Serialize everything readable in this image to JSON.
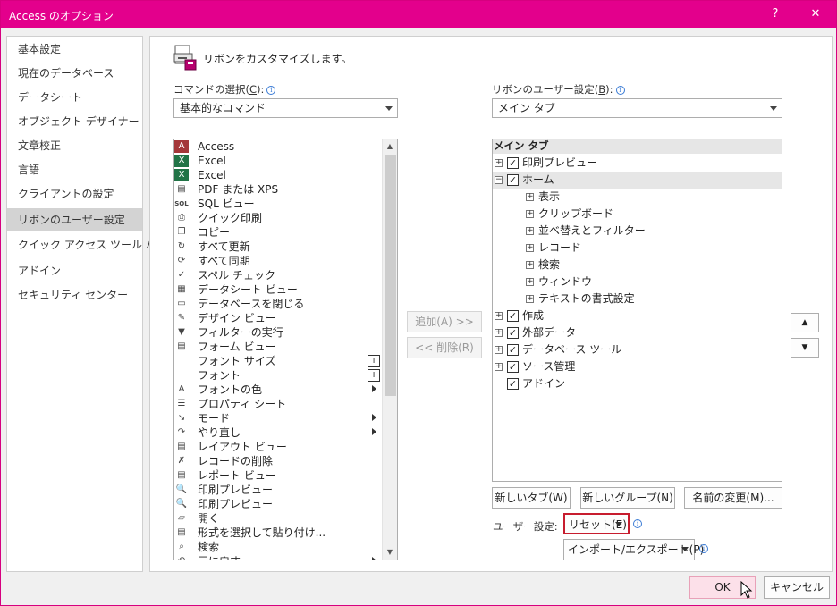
{
  "window": {
    "title": "Access のオプション",
    "help": "?",
    "close": "✕"
  },
  "nav": {
    "items": [
      {
        "label": "基本設定"
      },
      {
        "label": "現在のデータベース"
      },
      {
        "label": "データシート"
      },
      {
        "label": "オブジェクト デザイナー"
      },
      {
        "label": "文章校正"
      },
      {
        "label": "言語"
      },
      {
        "label": "クライアントの設定"
      },
      {
        "label": "リボンのユーザー設定"
      },
      {
        "label": "クイック アクセス ツール バー"
      },
      {
        "label": "アドイン"
      },
      {
        "label": "セキュリティ センター"
      }
    ],
    "active_index": 7
  },
  "heading": "リボンをカスタマイズします。",
  "left_panel": {
    "label": "コマンドの選択(",
    "label_key": "C",
    "label_end": "):",
    "combo_value": "基本的なコマンド",
    "commands": [
      {
        "label": "Access",
        "icon": "A"
      },
      {
        "label": "Excel",
        "icon": "X"
      },
      {
        "label": "Excel",
        "icon": "X"
      },
      {
        "label": "PDF または XPS",
        "icon": "▤"
      },
      {
        "label": "SQL ビュー",
        "icon": "SQL"
      },
      {
        "label": "クイック印刷",
        "icon": "⎙"
      },
      {
        "label": "コピー",
        "icon": "❐"
      },
      {
        "label": "すべて更新",
        "icon": "↻"
      },
      {
        "label": "すべて同期",
        "icon": "⟳"
      },
      {
        "label": "スペル チェック",
        "icon": "✓"
      },
      {
        "label": "データシート ビュー",
        "icon": "▦"
      },
      {
        "label": "データベースを閉じる",
        "icon": "▭"
      },
      {
        "label": "デザイン ビュー",
        "icon": "✎"
      },
      {
        "label": "フィルターの実行",
        "icon": "▼"
      },
      {
        "label": "フォーム ビュー",
        "icon": "▤"
      },
      {
        "label": "フォント サイズ",
        "icon": "",
        "inline_box": "I"
      },
      {
        "label": "フォント",
        "icon": "",
        "inline_box": "I"
      },
      {
        "label": "フォントの色",
        "icon": "A",
        "submenu": true
      },
      {
        "label": "プロパティ シート",
        "icon": "☰"
      },
      {
        "label": "モード",
        "icon": "↘",
        "submenu": true
      },
      {
        "label": "やり直し",
        "icon": "↷",
        "submenu": true
      },
      {
        "label": "レイアウト ビュー",
        "icon": "▤"
      },
      {
        "label": "レコードの削除",
        "icon": "✗"
      },
      {
        "label": "レポート ビュー",
        "icon": "▤"
      },
      {
        "label": "印刷プレビュー",
        "icon": "🔍"
      },
      {
        "label": "印刷プレビュー",
        "icon": "🔍"
      },
      {
        "label": "開く",
        "icon": "▱"
      },
      {
        "label": "形式を選択して貼り付け...",
        "icon": "▤"
      },
      {
        "label": "検索",
        "icon": "⌕"
      },
      {
        "label": "元に戻す",
        "icon": "↶",
        "submenu": true
      }
    ]
  },
  "middle": {
    "add_label": "追加(A) >>",
    "remove_label": "<< 削除(R)"
  },
  "right_panel": {
    "label": "リボンのユーザー設定(",
    "label_key": "B",
    "label_end": "):",
    "combo_value": "メイン タブ",
    "tree_header": "メイン タブ",
    "tree": [
      {
        "label": "印刷プレビュー",
        "level": 0,
        "expander": "+",
        "checked": true
      },
      {
        "label": "ホーム",
        "level": 0,
        "expander": "−",
        "checked": true,
        "selected": true
      },
      {
        "label": "表示",
        "level": 1,
        "expander": "+"
      },
      {
        "label": "クリップボード",
        "level": 1,
        "expander": "+"
      },
      {
        "label": "並べ替えとフィルター",
        "level": 1,
        "expander": "+"
      },
      {
        "label": "レコード",
        "level": 1,
        "expander": "+"
      },
      {
        "label": "検索",
        "level": 1,
        "expander": "+"
      },
      {
        "label": "ウィンドウ",
        "level": 1,
        "expander": "+"
      },
      {
        "label": "テキストの書式設定",
        "level": 1,
        "expander": "+"
      },
      {
        "label": "作成",
        "level": 0,
        "expander": "+",
        "checked": true
      },
      {
        "label": "外部データ",
        "level": 0,
        "expander": "+",
        "checked": true
      },
      {
        "label": "データベース ツール",
        "level": 0,
        "expander": "+",
        "checked": true
      },
      {
        "label": "ソース管理",
        "level": 0,
        "expander": "+",
        "checked": true
      },
      {
        "label": "アドイン",
        "level": 0,
        "expander": "",
        "checked": true
      }
    ],
    "new_tab": "新しいタブ(W)",
    "new_group": "新しいグループ(N)",
    "rename": "名前の変更(M)...",
    "user_setting_label": "ユーザー設定:",
    "reset": "リセット(E)",
    "import_export": "インポート/エクスポート(P)",
    "move_up": "▲",
    "move_down": "▼"
  },
  "footer": {
    "ok": "OK",
    "cancel": "キャンセル"
  },
  "colors": {
    "title_bar": "#e3008c",
    "selected_nav": "#d3d3d3",
    "focus_border": "#c71c2e"
  }
}
